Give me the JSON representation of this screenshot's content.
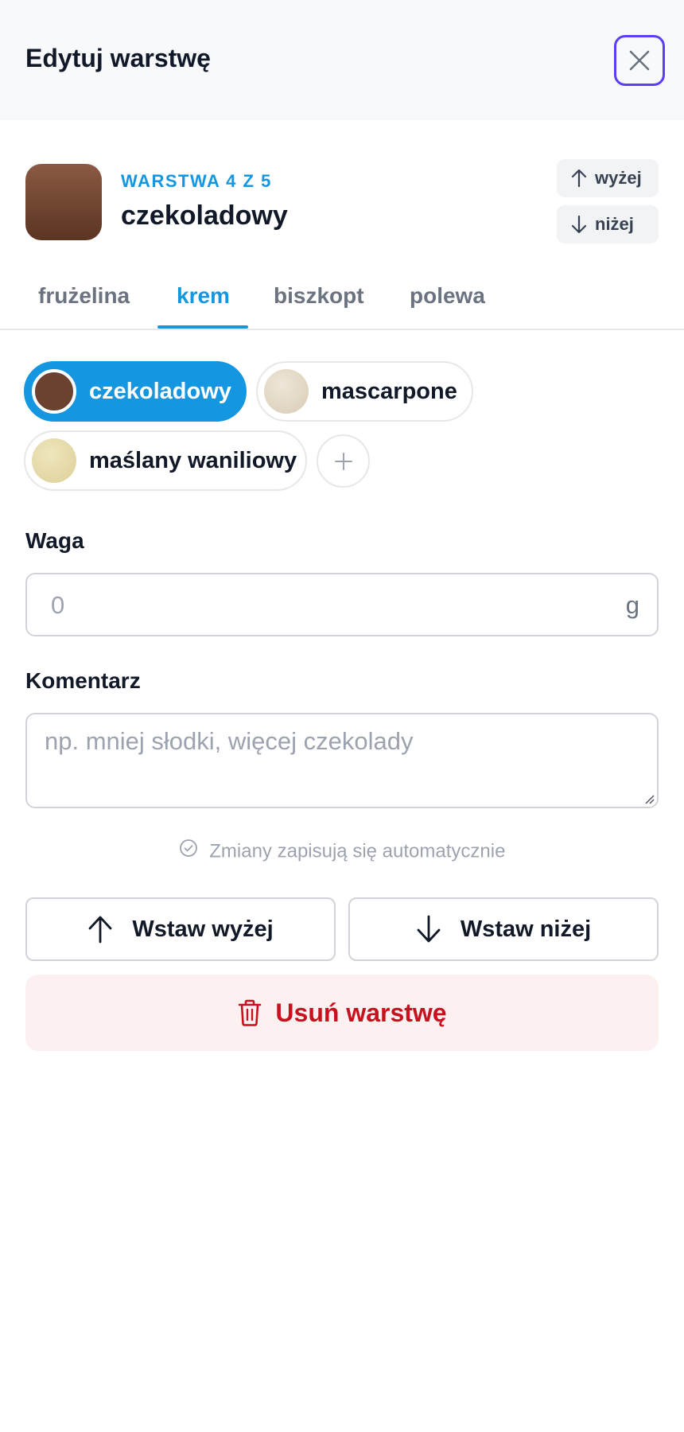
{
  "header": {
    "title": "Edytuj warstwę",
    "close_icon": "close-icon"
  },
  "layer": {
    "position_label": "WARSTWA 4 Z 5",
    "name": "czekoladowy",
    "swatch_color": "#6e4430",
    "move_up_label": "wyżej",
    "move_down_label": "niżej"
  },
  "tabs": [
    {
      "label": "frużelina",
      "active": false
    },
    {
      "label": "krem",
      "active": true
    },
    {
      "label": "biszkopt",
      "active": false
    },
    {
      "label": "polewa",
      "active": false
    }
  ],
  "flavors": [
    {
      "label": "czekoladowy",
      "color": "#6b4230",
      "selected": true
    },
    {
      "label": "mascarpone",
      "color": "#e2d8c6",
      "selected": false
    },
    {
      "label": "maślany waniliowy",
      "color": "#e6dcaa",
      "selected": false
    }
  ],
  "weight": {
    "label": "Waga",
    "placeholder": "0",
    "value": "",
    "unit": "g"
  },
  "comment": {
    "label": "Komentarz",
    "placeholder": "np. mniej słodki, więcej czekolady",
    "value": ""
  },
  "autosave_text": "Zmiany zapisują się automatycznie",
  "actions": {
    "insert_above": "Wstaw wyżej",
    "insert_below": "Wstaw niżej",
    "delete": "Usuń warstwę"
  },
  "colors": {
    "accent": "#1596e0",
    "focus_ring": "#5b3df5",
    "danger": "#c8101e",
    "danger_bg": "#fdf0f0"
  }
}
